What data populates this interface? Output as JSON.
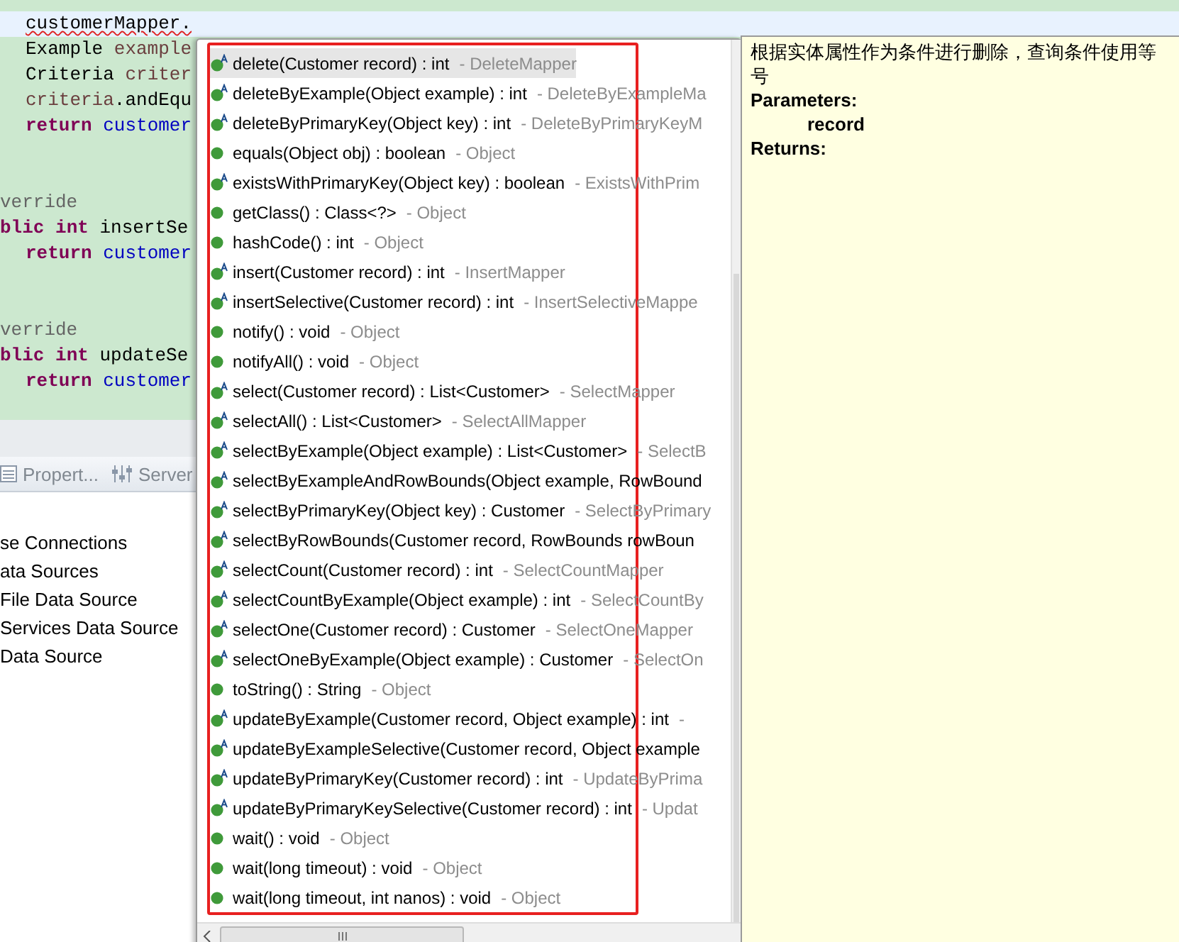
{
  "editor": {
    "lines": [
      {
        "current": true,
        "tokens": [
          {
            "kind": "error",
            "text": "customerMapper."
          }
        ]
      },
      {
        "current": false,
        "tokens": [
          {
            "kind": "plain",
            "text": "Example",
            "space_after": true
          },
          {
            "kind": "local",
            "text": "example"
          }
        ]
      },
      {
        "current": false,
        "tokens": [
          {
            "kind": "plain",
            "text": "Criteria",
            "space_after": true
          },
          {
            "kind": "local",
            "text": "criter"
          }
        ]
      },
      {
        "current": false,
        "tokens": [
          {
            "kind": "local",
            "text": "criteria"
          },
          {
            "kind": "plain",
            "text": ".andEqu"
          }
        ]
      },
      {
        "current": false,
        "tokens": [
          {
            "kind": "keyword",
            "text": "return",
            "space_after": true
          },
          {
            "kind": "field",
            "text": "customer"
          }
        ]
      },
      {
        "current": false
      },
      {
        "current": false
      },
      {
        "current": false,
        "outdent": true,
        "tokens": [
          {
            "kind": "annotation",
            "text": "verride"
          }
        ]
      },
      {
        "current": false,
        "outdent": true,
        "tokens": [
          {
            "kind": "keyword",
            "text": "blic",
            "space_after": true
          },
          {
            "kind": "keyword",
            "text": "int",
            "space_after": true
          },
          {
            "kind": "plain",
            "text": "insertSe"
          }
        ]
      },
      {
        "current": false,
        "tokens": [
          {
            "kind": "keyword",
            "text": "return",
            "space_after": true
          },
          {
            "kind": "field",
            "text": "customer"
          }
        ]
      },
      {
        "current": false
      },
      {
        "current": false
      },
      {
        "current": false,
        "outdent": true,
        "tokens": [
          {
            "kind": "annotation",
            "text": "verride"
          }
        ]
      },
      {
        "current": false,
        "outdent": true,
        "tokens": [
          {
            "kind": "keyword",
            "text": "blic",
            "space_after": true
          },
          {
            "kind": "keyword",
            "text": "int",
            "space_after": true
          },
          {
            "kind": "plain",
            "text": "updateSe"
          }
        ]
      },
      {
        "current": false,
        "tokens": [
          {
            "kind": "keyword",
            "text": "return",
            "space_after": true
          },
          {
            "kind": "field",
            "text": "customer"
          }
        ]
      }
    ]
  },
  "views": {
    "tabs": [
      {
        "label": "Propert...",
        "kind": "properties",
        "selected": false
      },
      {
        "label": "Server",
        "kind": "servers",
        "selected": false
      }
    ],
    "tree": [
      "se Connections",
      "ata Sources",
      "File Data Source",
      "Services Data Source",
      "Data Source"
    ]
  },
  "completion": {
    "items": [
      {
        "kind": "interface",
        "selected": true,
        "signature": "delete(Customer record) : int",
        "detail": "- DeleteMapper"
      },
      {
        "kind": "interface",
        "selected": false,
        "signature": "deleteByExample(Object example) : int",
        "detail": "- DeleteByExampleMa"
      },
      {
        "kind": "interface",
        "selected": false,
        "signature": "deleteByPrimaryKey(Object key) : int",
        "detail": "- DeleteByPrimaryKeyM"
      },
      {
        "kind": "method",
        "selected": false,
        "signature": "equals(Object obj) : boolean",
        "detail": "- Object"
      },
      {
        "kind": "interface",
        "selected": false,
        "signature": "existsWithPrimaryKey(Object key) : boolean",
        "detail": "- ExistsWithPrim"
      },
      {
        "kind": "method",
        "selected": false,
        "signature": "getClass() : Class<?>",
        "detail": "- Object"
      },
      {
        "kind": "method",
        "selected": false,
        "signature": "hashCode() : int",
        "detail": "- Object"
      },
      {
        "kind": "interface",
        "selected": false,
        "signature": "insert(Customer record) : int",
        "detail": "- InsertMapper"
      },
      {
        "kind": "interface",
        "selected": false,
        "signature": "insertSelective(Customer record) : int",
        "detail": "- InsertSelectiveMappe"
      },
      {
        "kind": "method",
        "selected": false,
        "signature": "notify() : void",
        "detail": "- Object"
      },
      {
        "kind": "method",
        "selected": false,
        "signature": "notifyAll() : void",
        "detail": "- Object"
      },
      {
        "kind": "interface",
        "selected": false,
        "signature": "select(Customer record) : List<Customer>",
        "detail": "- SelectMapper"
      },
      {
        "kind": "interface",
        "selected": false,
        "signature": "selectAll() : List<Customer>",
        "detail": "- SelectAllMapper"
      },
      {
        "kind": "interface",
        "selected": false,
        "signature": "selectByExample(Object example) : List<Customer>",
        "detail": "- SelectB"
      },
      {
        "kind": "interface",
        "selected": false,
        "signature": "selectByExampleAndRowBounds(Object example, RowBound"
      },
      {
        "kind": "interface",
        "selected": false,
        "signature": "selectByPrimaryKey(Object key) : Customer",
        "detail": "- SelectByPrimary"
      },
      {
        "kind": "interface",
        "selected": false,
        "signature": "selectByRowBounds(Customer record, RowBounds rowBoun"
      },
      {
        "kind": "interface",
        "selected": false,
        "signature": "selectCount(Customer record) : int",
        "detail": "- SelectCountMapper"
      },
      {
        "kind": "interface",
        "selected": false,
        "signature": "selectCountByExample(Object example) : int",
        "detail": "- SelectCountBy"
      },
      {
        "kind": "interface",
        "selected": false,
        "signature": "selectOne(Customer record) : Customer",
        "detail": "- SelectOneMapper"
      },
      {
        "kind": "interface",
        "selected": false,
        "signature": "selectOneByExample(Object example) : Customer",
        "detail": "- SelectOn"
      },
      {
        "kind": "method",
        "selected": false,
        "signature": "toString() : String",
        "detail": "- Object"
      },
      {
        "kind": "interface",
        "selected": false,
        "signature": "updateByExample(Customer record, Object example) : int",
        "detail": "-"
      },
      {
        "kind": "interface",
        "selected": false,
        "signature": "updateByExampleSelective(Customer record, Object example"
      },
      {
        "kind": "interface",
        "selected": false,
        "signature": "updateByPrimaryKey(Customer record) : int",
        "detail": "- UpdateByPrima"
      },
      {
        "kind": "interface",
        "selected": false,
        "signature": "updateByPrimaryKeySelective(Customer record) : int",
        "detail": "- Updat"
      },
      {
        "kind": "method",
        "selected": false,
        "signature": "wait() : void",
        "detail": "- Object"
      },
      {
        "kind": "method",
        "selected": false,
        "signature": "wait(long timeout) : void",
        "detail": "- Object"
      },
      {
        "kind": "method",
        "selected": false,
        "signature": "wait(long timeout, int nanos) : void",
        "detail": "- Object"
      }
    ]
  },
  "doc": {
    "description": "根据实体属性作为条件进行删除，查询条件使用等号",
    "parameters_heading": "Parameters:",
    "parameter": "record",
    "returns_heading": "Returns:"
  }
}
